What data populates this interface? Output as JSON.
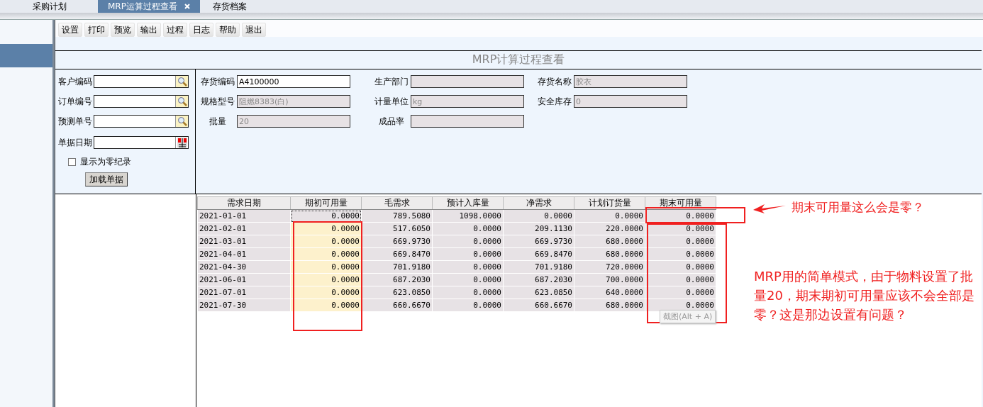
{
  "tabs": [
    {
      "label": "采购计划",
      "selected": false,
      "closable": false
    },
    {
      "label": "MRP运算过程查看",
      "selected": true,
      "closable": true
    },
    {
      "label": "存货档案",
      "selected": false,
      "closable": false
    }
  ],
  "toolbar": [
    "设置",
    "打印",
    "预览",
    "输出",
    "过程",
    "日志",
    "帮助",
    "退出"
  ],
  "title": "MRP计算过程查看",
  "query_fields": [
    {
      "label": "客户编码",
      "kind": "lookup"
    },
    {
      "label": "订单编号",
      "kind": "lookup"
    },
    {
      "label": "预测单号",
      "kind": "lookup"
    },
    {
      "label": "单据日期",
      "kind": "date"
    }
  ],
  "show_zero": {
    "label": "显示为零纪录",
    "checked": false
  },
  "load_button": "加载单据",
  "item_fields": [
    {
      "label": "存货编码",
      "value": "A4100000",
      "disabled": false
    },
    {
      "label": "生产部门",
      "disabled": true
    },
    {
      "label": "存货名称",
      "value": "胶衣",
      "disabled": true
    },
    {
      "label": "规格型号",
      "value": "阻燃8383(白)",
      "disabled": true
    },
    {
      "label": "计量单位",
      "value": "kg",
      "disabled": true
    },
    {
      "label": "安全库存",
      "value": "0",
      "disabled": true
    },
    {
      "label": "批量",
      "value": "20",
      "disabled": true
    },
    {
      "label": "成品率",
      "disabled": true
    }
  ],
  "table": {
    "columns": [
      "需求日期",
      "期初可用量",
      "毛需求",
      "预计入库量",
      "净需求",
      "计划订货量",
      "期末可用量"
    ],
    "rows": [
      {
        "focused": true,
        "highlighted": false,
        "cells": [
          "2021-01-01",
          "0.0000",
          "789.5080",
          "1098.0000",
          "0.0000",
          "0.0000",
          "0.0000"
        ]
      },
      {
        "focused": false,
        "highlighted": true,
        "cells": [
          "2021-02-01",
          "0.0000",
          "517.6050",
          "0.0000",
          "209.1130",
          "220.0000",
          "0.0000"
        ]
      },
      {
        "focused": false,
        "highlighted": true,
        "cells": [
          "2021-03-01",
          "0.0000",
          "669.9730",
          "0.0000",
          "669.9730",
          "680.0000",
          "0.0000"
        ]
      },
      {
        "focused": false,
        "highlighted": true,
        "cells": [
          "2021-04-01",
          "0.0000",
          "669.8470",
          "0.0000",
          "669.8470",
          "680.0000",
          "0.0000"
        ]
      },
      {
        "focused": false,
        "highlighted": true,
        "cells": [
          "2021-04-30",
          "0.0000",
          "701.9180",
          "0.0000",
          "701.9180",
          "720.0000",
          "0.0000"
        ]
      },
      {
        "focused": false,
        "highlighted": true,
        "cells": [
          "2021-06-01",
          "0.0000",
          "687.2030",
          "0.0000",
          "687.2030",
          "700.0000",
          "0.0000"
        ]
      },
      {
        "focused": false,
        "highlighted": true,
        "cells": [
          "2021-07-01",
          "0.0000",
          "623.0850",
          "0.0000",
          "623.0850",
          "640.0000",
          "0.0000"
        ]
      },
      {
        "focused": false,
        "highlighted": true,
        "cells": [
          "2021-07-30",
          "0.0000",
          "660.6670",
          "0.0000",
          "660.6670",
          "680.0000",
          "0.0000"
        ]
      }
    ]
  },
  "tooltip": "截图(Alt + A)",
  "annotations": {
    "question": "期末可用量这么会是零？",
    "note": "MRP用的简单模式，由于物料设置了批量20，期末期初可用量应该不会全部是零？这是那边设置有问题？"
  }
}
